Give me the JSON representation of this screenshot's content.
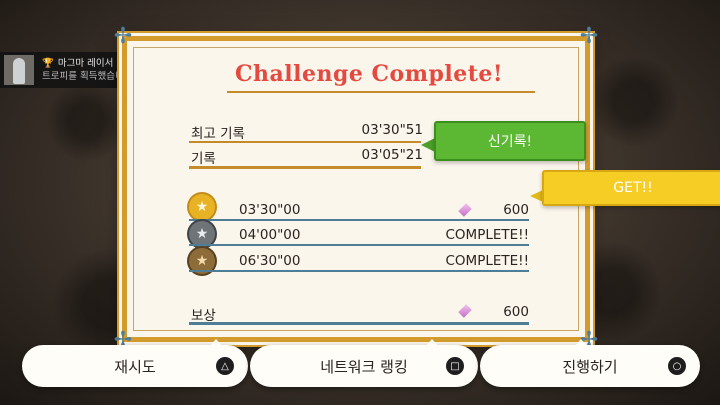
{
  "toast": {
    "title": "마그마 레이서 레볼루션",
    "subtitle": "트로피를 획득했습니다!",
    "platform_icon": "playstation-icon",
    "trophy_icon": "trophy-icon"
  },
  "panel": {
    "title": "Challenge Complete!",
    "best_record": {
      "label": "최고 기록",
      "value": "03'30\"51"
    },
    "record": {
      "label": "기록",
      "value": "03'05\"21"
    },
    "new_record_badge": "신기록!",
    "get_badge": "GET!!",
    "medals": [
      {
        "tier": "gold",
        "time": "03'30\"00",
        "result": "600",
        "result_type": "crystal"
      },
      {
        "tier": "silver",
        "time": "04'00\"00",
        "result": "COMPLETE!!",
        "result_type": "text"
      },
      {
        "tier": "bronze",
        "time": "06'30\"00",
        "result": "COMPLETE!!",
        "result_type": "text"
      }
    ],
    "reward": {
      "label": "보상",
      "value": "600"
    }
  },
  "buttons": [
    {
      "label": "재시도",
      "icon": "triangle-icon",
      "glyph": "△"
    },
    {
      "label": "네트워크 랭킹",
      "icon": "square-icon",
      "glyph": "□"
    },
    {
      "label": "진행하기",
      "icon": "circle-icon",
      "glyph": "○"
    }
  ],
  "colors": {
    "title": "#e44a3f",
    "panel_border": "#d39a2c",
    "green_badge": "#5cb833",
    "yellow_badge": "#f5cd25"
  }
}
